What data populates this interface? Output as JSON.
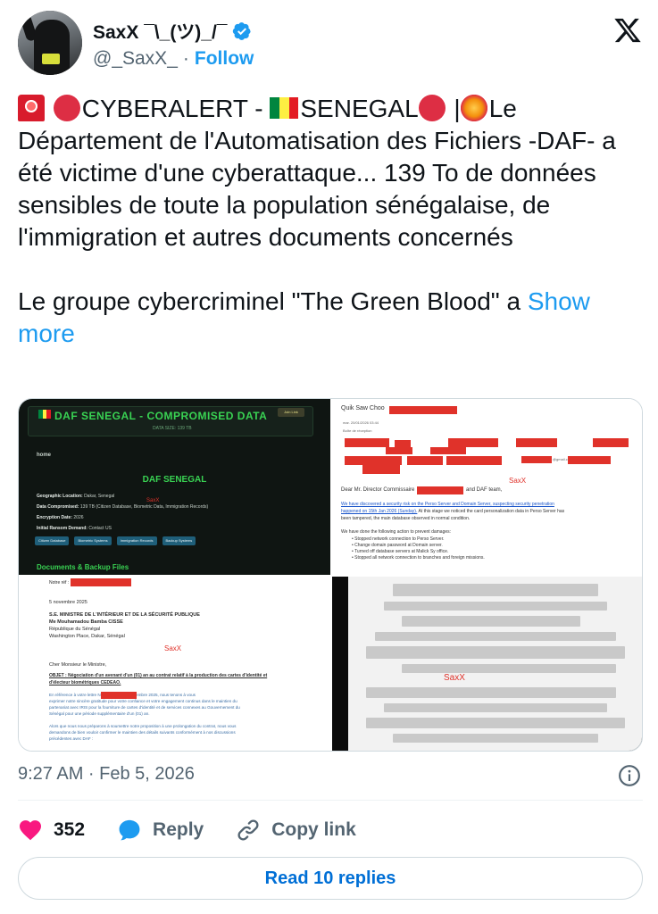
{
  "author": {
    "display_name": "SaxX ¯\\_(ツ)_/¯",
    "handle": "@_SaxX_",
    "separator": "·",
    "follow_label": "Follow",
    "verified": true,
    "avatar_icon": "user-avatar"
  },
  "tweet": {
    "line1_a": "CYBERALERT - ",
    "line1_b": "SENEGAL",
    "line1_c": " |",
    "line1_d": "Le",
    "body_rest": "Département de l'Automatisation des Fichiers -DAF- a été victime d'une cyberattaque... 139 To de données sensibles de toute la population sénégalaise, de l'immigration et autres documents concernés",
    "para2": "Le groupe cybercriminel \"The Green Blood\" a ",
    "show_more": "Show more",
    "emojis": [
      "siren-emoji",
      "red-circle-emoji",
      "senegal-flag-emoji",
      "red-circle-emoji",
      "collision-emoji"
    ]
  },
  "media": {
    "image1": {
      "title": "DAF SENEGAL - COMPROMISED DATA",
      "subtitle": "DATA SIZE: 139 TB",
      "button": "Join Link",
      "nav": "home",
      "heading": "DAF SENEGAL",
      "watermark": "SaxX",
      "fields": [
        {
          "label": "Geographic Location:",
          "value": "Dakar, Senegal"
        },
        {
          "label": "Data Compromised:",
          "value": "139 TB (Citizen Database, Biometric Data, Immigration Records)"
        },
        {
          "label": "Encryption Date:",
          "value": "2026"
        },
        {
          "label": "Initial Ransom Demand:",
          "value": "Contact US"
        }
      ],
      "chips": [
        "Citizen Database",
        "Biometric Systems",
        "Immigration Records",
        "Backup Systems"
      ],
      "section": "Documents & Backup Files"
    },
    "image2": {
      "from": "Quik Saw Choo",
      "date": "mar. 20/01/2026 03:44",
      "folder": "Boîte de réception",
      "watermark": "SaxX",
      "greeting": "Dear Mr. Director Commissaire",
      "greeting_end": "and DAF team,",
      "p1_link": "We have discovered a security risk on the Perso Server and Domain Server, suspecting security penetration",
      "p1_link2": "happened on 15th Jan 2026 (Sunday).",
      "p1_rest": " At this stage we noticed the card personalization data in Perso Server has",
      "p1_rest2": "been tampered, the main database observed in normal condition.",
      "p2": "We have done the following action to prevent damages:",
      "bullets": [
        "Stopped network connection to Perso Server.",
        "Change domain password at Domain server.",
        "Turned off database servers at Malick Sy office.",
        "Stopped all network connection to branches and foreign missions."
      ],
      "email_suffix": "@gmail.com"
    },
    "image3": {
      "ref": "Notre réf :",
      "date": "5 novembre 2025",
      "recipient": [
        "S.E. MINISTRE DE L'INTÉRIEUR ET DE LA SÉCURITÉ PUBLIQUE",
        "Me Mouhamadou Bamba CISSE",
        "République du Sénégal",
        "Washington Place, Dakar, Sénégal"
      ],
      "watermark": "SaxX",
      "salutation": "Cher Monsieur le Ministre,",
      "objet": "OBJET : Négociation d'un avenant d'un (01) an au contrat relatif à la production des cartes d'identité et",
      "objet2": "d'électeur biométriques CEDEAO.",
      "body": [
        "En référence à votre lettre No.                           en date du 3 novembre 2025, nous tenons à vous",
        "exprimer notre sincère gratitude pour votre confiance et votre engagement continus dans le maintien du",
        "partenariat avec IRIS pour la fourniture de cartes d'identité et de services connexes au Gouvernement du",
        "Sénégal pour une période supplémentaire d'un (01) an.",
        "",
        "Alors que nous nous préparons à soumettre notre proposition à une prolongation du contrat, nous vous",
        "demandons de bien vouloir confirmer le maintien des détails suivants conformément à nos discussions",
        "précédentes avec DAF :"
      ]
    },
    "image4": {
      "watermark": "SaxX"
    }
  },
  "meta": {
    "timestamp": "9:27 AM · Feb 5, 2026"
  },
  "actions": {
    "like_count": "352",
    "reply_label": "Reply",
    "copy_link_label": "Copy link"
  },
  "read_replies_label": "Read 10 replies",
  "colors": {
    "accent": "#1d9bf0",
    "like": "#f91880",
    "secondary_text": "#536471",
    "redaction": "#e0322a"
  }
}
